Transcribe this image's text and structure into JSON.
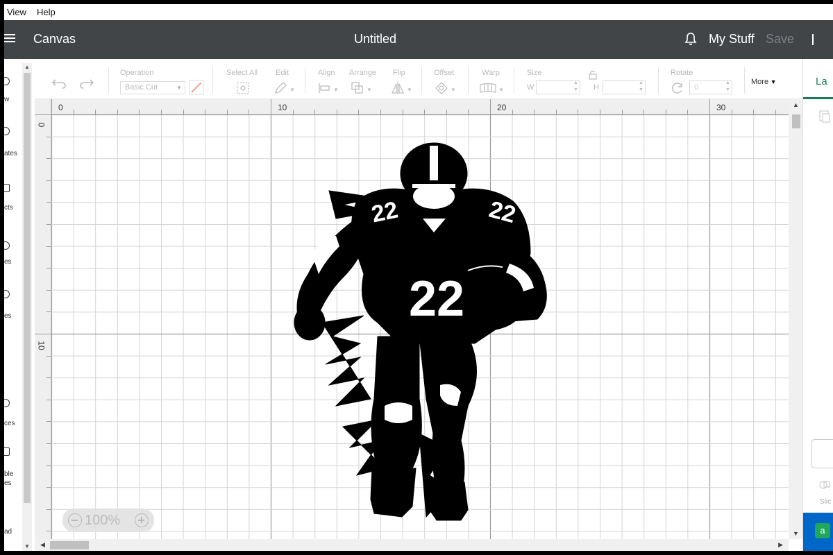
{
  "menubar": {
    "view": "View",
    "help": "Help"
  },
  "header": {
    "canvas_label": "Canvas",
    "document_title": "Untitled",
    "my_stuff": "My Stuff",
    "save": "Save"
  },
  "left_panel": {
    "items": [
      "w",
      "ates",
      "cts",
      "es",
      "es",
      "ces",
      "ble",
      "es",
      "ad"
    ]
  },
  "toolbar": {
    "operation_label": "Operation",
    "operation_value": "Basic Cut",
    "select_all": "Select All",
    "edit": "Edit",
    "align": "Align",
    "arrange": "Arrange",
    "flip": "Flip",
    "offset": "Offset",
    "warp": "Warp",
    "size": "Size",
    "width_label": "W",
    "height_label": "H",
    "rotate": "Rotate",
    "rotate_value": "0",
    "more": "More"
  },
  "rulers": {
    "top": [
      "0",
      "10",
      "20",
      "30"
    ],
    "left": [
      "0",
      "10"
    ]
  },
  "zoom": {
    "value": "100%"
  },
  "right_panel": {
    "layers_tab": "La",
    "slice": "Slic"
  },
  "image": {
    "jersey_number": "22",
    "description_icon": "football-player-icon"
  },
  "colors": {
    "header_bg": "#414548",
    "accent_green": "#1b7b56",
    "grid_major": "#9a9a9a",
    "grid_minor": "#d4d4d4"
  }
}
